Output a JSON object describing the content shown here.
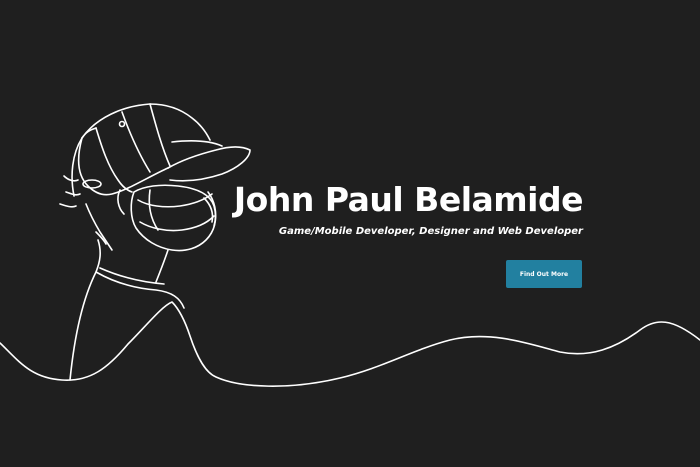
{
  "hero": {
    "name": "John Paul Belamide",
    "subtitle": "Game/Mobile Developer, Designer and Web Developer",
    "cta_label": "Find Out More"
  },
  "colors": {
    "background": "#1f1f1f",
    "line": "#ffffff",
    "accent": "#2280a0",
    "text": "#ffffff"
  },
  "illustration": {
    "subject": "portrait-line-drawing",
    "icon": "person-in-cap-with-face-mask"
  }
}
